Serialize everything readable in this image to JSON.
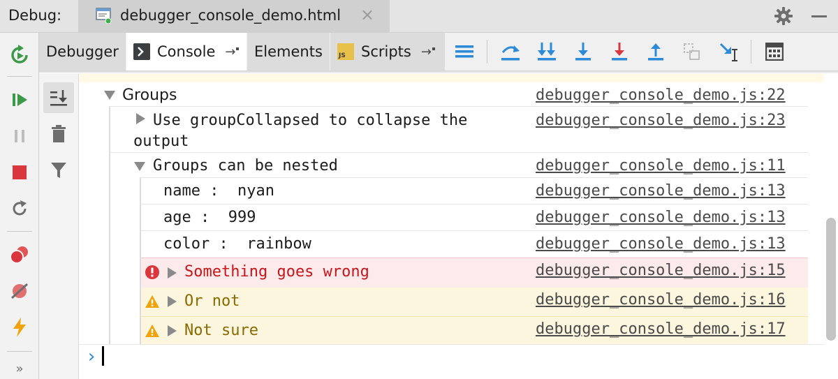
{
  "titlebar": {
    "label": "Debug:",
    "file_tab": "debugger_console_demo.html",
    "close_glyph": "×"
  },
  "tabs": [
    {
      "label": "Debugger",
      "active": false
    },
    {
      "label": "Console",
      "active": true
    },
    {
      "label": "Elements",
      "active": false
    },
    {
      "label": "Scripts",
      "active": false
    }
  ],
  "icons": {
    "scripts_badge": "JS",
    "pin_glyph": "→",
    "more_glyph": "»"
  },
  "console": {
    "rows": [
      {
        "kind": "group",
        "text": "Groups",
        "source": "debugger_console_demo.js:22"
      },
      {
        "kind": "collapsed",
        "text_line1": "Use groupCollapsed to collapse the",
        "text_line2": "output",
        "source": "debugger_console_demo.js:23"
      },
      {
        "kind": "group",
        "text": "Groups can be nested",
        "source": "debugger_console_demo.js:11"
      },
      {
        "kind": "log",
        "text": "name :  nyan",
        "source": "debugger_console_demo.js:13"
      },
      {
        "kind": "log",
        "text": "age :  999",
        "source": "debugger_console_demo.js:13"
      },
      {
        "kind": "log",
        "text": "color :  rainbow",
        "source": "debugger_console_demo.js:13"
      },
      {
        "kind": "error",
        "text": "Something goes wrong",
        "source": "debugger_console_demo.js:15"
      },
      {
        "kind": "warning",
        "text": "Or not",
        "source": "debugger_console_demo.js:16"
      },
      {
        "kind": "warning",
        "text": "Not sure",
        "source": "debugger_console_demo.js:17"
      }
    ],
    "prompt_glyph": "›"
  },
  "colors": {
    "error_text": "#c7161b",
    "warning_text": "#8a6a00",
    "error_bg": "#fdeaea",
    "warning_bg": "#fcf6df",
    "accent_blue": "#2d8ad9"
  }
}
